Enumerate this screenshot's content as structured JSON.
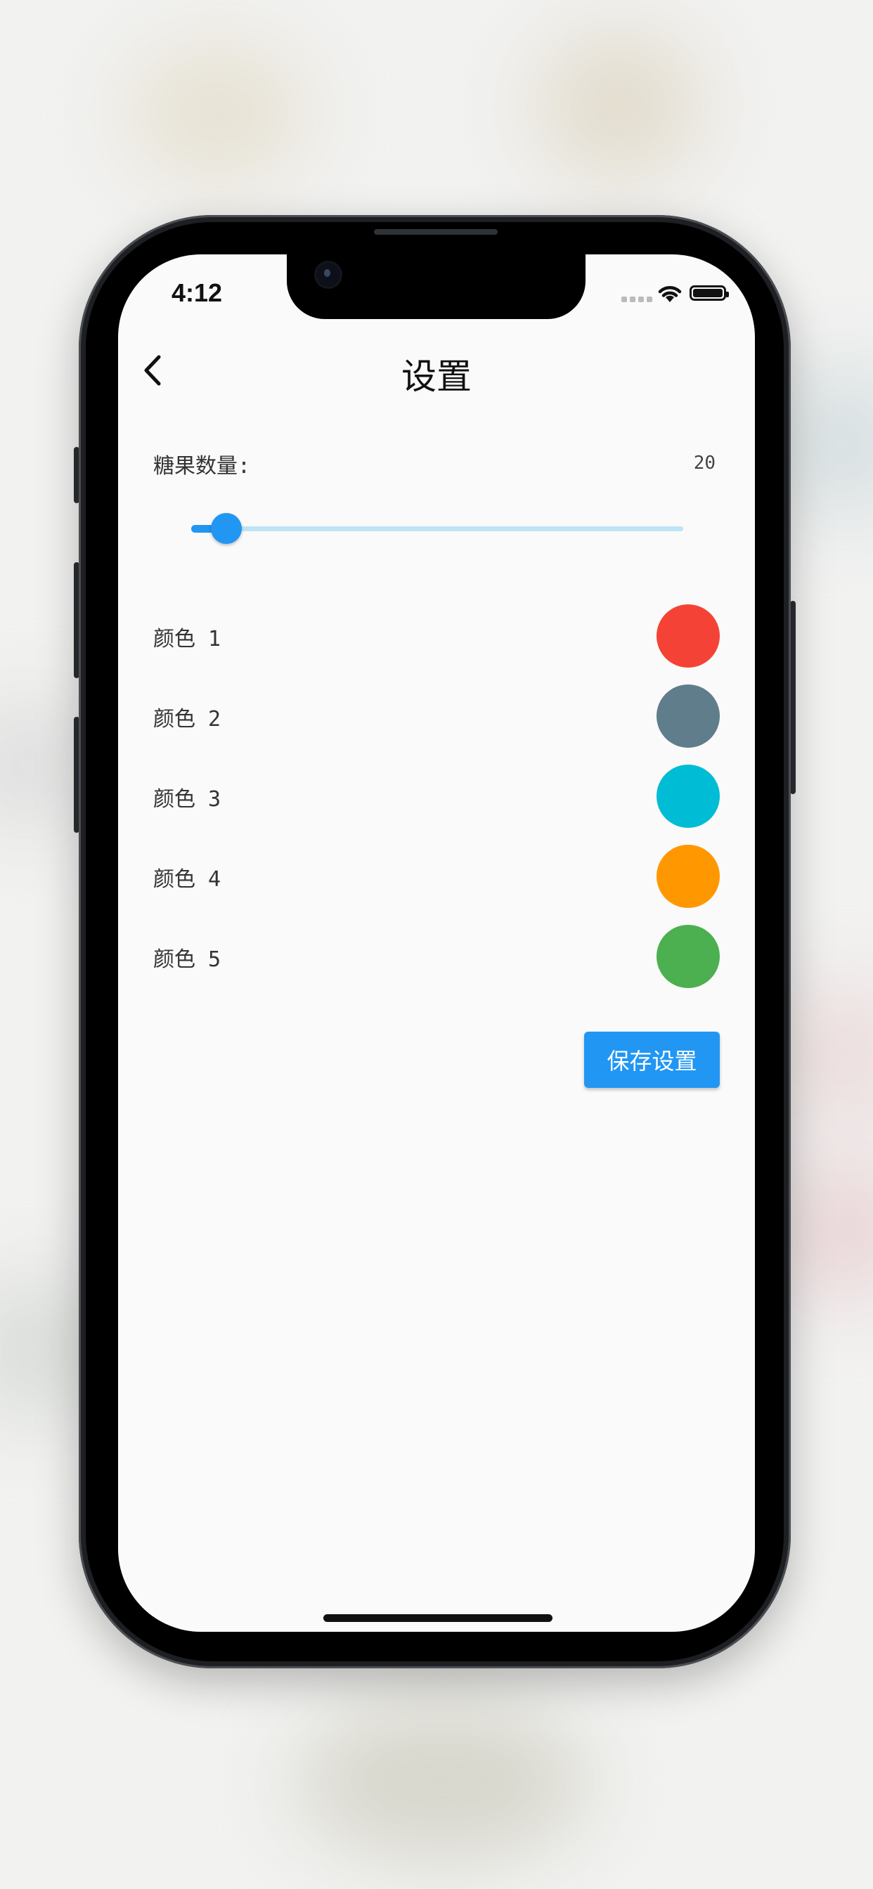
{
  "status_bar": {
    "time": "4:12"
  },
  "header": {
    "title": "设置"
  },
  "candy": {
    "label": "糖果数量:",
    "value": "20",
    "slider_fraction": 0.04
  },
  "colors": [
    {
      "label": "颜色 1",
      "hex": "#f44336"
    },
    {
      "label": "颜色 2",
      "hex": "#607d8b"
    },
    {
      "label": "颜色 3",
      "hex": "#00bcd4"
    },
    {
      "label": "颜色 4",
      "hex": "#ff9800"
    },
    {
      "label": "颜色 5",
      "hex": "#4caf50"
    }
  ],
  "actions": {
    "save_label": "保存设置"
  },
  "theme": {
    "accent": "#2196f3",
    "accent_light": "#bfe3f6"
  },
  "icons": {
    "back": "chevron-left-icon",
    "wifi": "wifi-icon",
    "battery": "battery-icon"
  }
}
